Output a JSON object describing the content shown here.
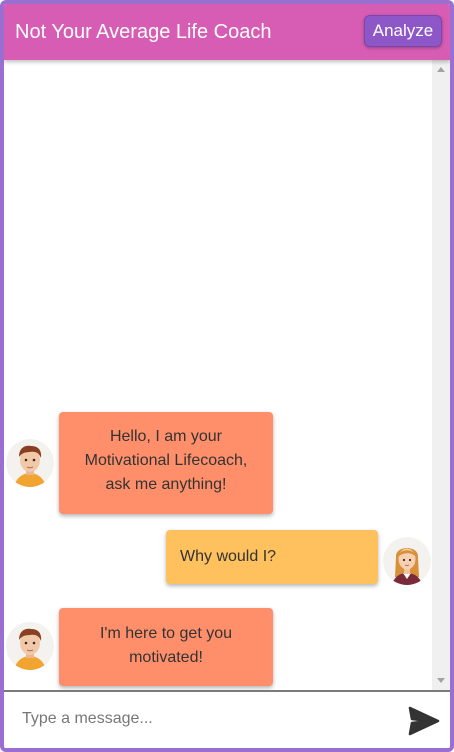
{
  "header": {
    "title": "Not Your Average Life Coach",
    "analyze_label": "Analyze"
  },
  "messages": [
    {
      "sender": "bot",
      "avatar": "male-coach-avatar",
      "lines": [
        "Hello, I am your",
        "Motivational Lifecoach,",
        "ask me anything!"
      ]
    },
    {
      "sender": "user",
      "avatar": "female-user-avatar",
      "lines": [
        "Why would I?"
      ]
    },
    {
      "sender": "bot",
      "avatar": "male-coach-avatar",
      "lines": [
        "I'm here to get you",
        "motivated!"
      ]
    }
  ],
  "composer": {
    "placeholder": "Type a message...",
    "send_icon": "send-icon"
  },
  "colors": {
    "header": "#d65db3",
    "frame": "#9b6fd1",
    "analyze_button": "#8e57c8",
    "bot_bubble": "#ff8f6b",
    "user_bubble": "#ffc15e"
  }
}
